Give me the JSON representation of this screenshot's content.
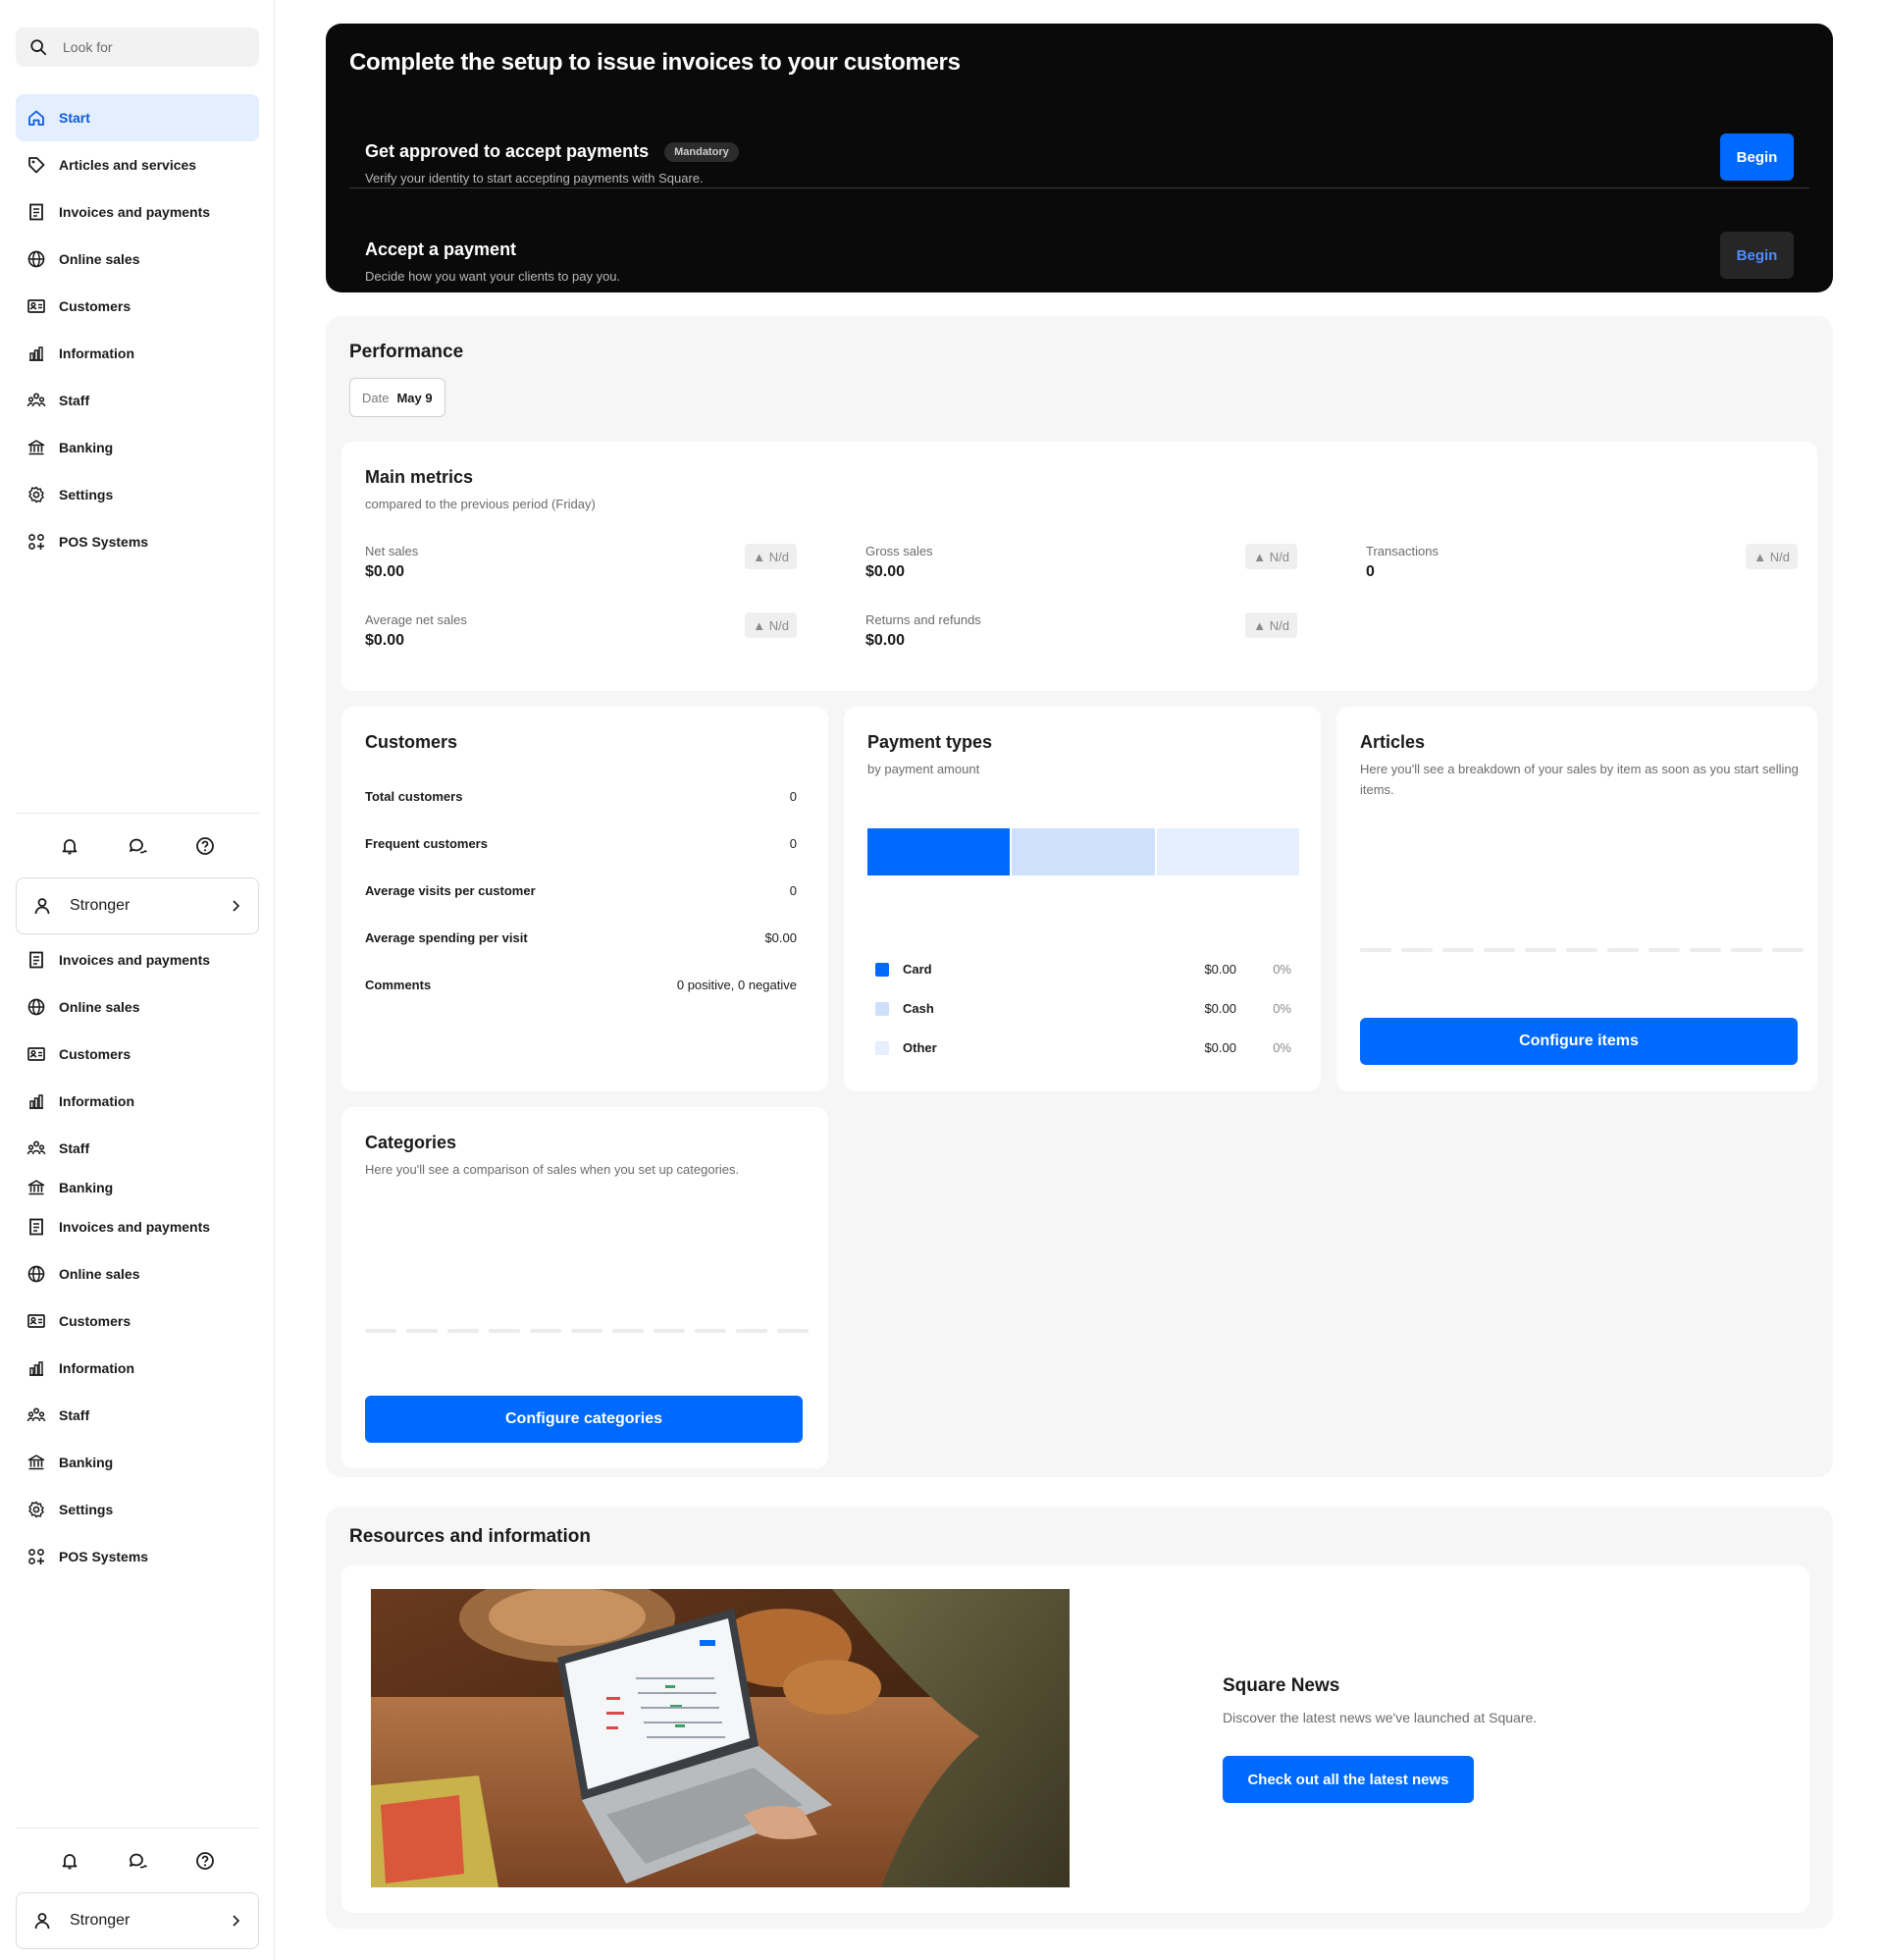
{
  "search": {
    "placeholder": "Look for"
  },
  "nav_primary": [
    {
      "label": "Start",
      "icon": "home-icon",
      "active": true
    },
    {
      "label": "Articles and services",
      "icon": "tag-icon"
    },
    {
      "label": "Invoices and payments",
      "icon": "invoice-icon"
    },
    {
      "label": "Online sales",
      "icon": "globe-icon"
    },
    {
      "label": "Customers",
      "icon": "contact-card-icon"
    },
    {
      "label": "Information",
      "icon": "bar-chart-icon"
    },
    {
      "label": "Staff",
      "icon": "people-icon"
    },
    {
      "label": "Banking",
      "icon": "bank-icon"
    },
    {
      "label": "Settings",
      "icon": "gear-icon"
    },
    {
      "label": "POS Systems",
      "icon": "apps-icon"
    }
  ],
  "nav_repeat_a": [
    {
      "label": "Invoices and payments",
      "icon": "invoice-icon"
    },
    {
      "label": "Online sales",
      "icon": "globe-icon"
    },
    {
      "label": "Customers",
      "icon": "contact-card-icon"
    },
    {
      "label": "Information",
      "icon": "bar-chart-icon"
    },
    {
      "label": "Staff",
      "icon": "people-icon"
    },
    {
      "label": "Banking",
      "icon": "bank-icon"
    }
  ],
  "nav_repeat_b": [
    {
      "label": "Invoices and payments",
      "icon": "invoice-icon"
    },
    {
      "label": "Online sales",
      "icon": "globe-icon"
    },
    {
      "label": "Customers",
      "icon": "contact-card-icon"
    },
    {
      "label": "Information",
      "icon": "bar-chart-icon"
    },
    {
      "label": "Staff",
      "icon": "people-icon"
    },
    {
      "label": "Banking",
      "icon": "bank-icon"
    },
    {
      "label": "Settings",
      "icon": "gear-icon"
    },
    {
      "label": "POS Systems",
      "icon": "apps-icon"
    }
  ],
  "user": {
    "name": "Stronger"
  },
  "setup": {
    "title": "Complete the setup to issue invoices to your customers",
    "step1": {
      "title": "Get approved to accept payments",
      "badge": "Mandatory",
      "desc": "Verify your identity to start accepting payments with Square.",
      "button": "Begin"
    },
    "step2": {
      "title": "Accept a payment",
      "desc": "Decide how you want your clients to pay you.",
      "button": "Begin"
    }
  },
  "performance": {
    "title": "Performance",
    "date_label": "Date",
    "date_value": "May 9",
    "main_metrics": {
      "title": "Main metrics",
      "subtitle": "compared to the previous period (Friday)",
      "metrics": [
        {
          "label": "Net sales",
          "value": "$0.00",
          "change": "▲ N/d"
        },
        {
          "label": "Gross sales",
          "value": "$0.00",
          "change": "▲ N/d"
        },
        {
          "label": "Transactions",
          "value": "0",
          "change": "▲ N/d"
        },
        {
          "label": "Average net sales",
          "value": "$0.00",
          "change": "▲ N/d"
        },
        {
          "label": "Returns and refunds",
          "value": "$0.00",
          "change": "▲ N/d"
        }
      ]
    },
    "customers": {
      "title": "Customers",
      "rows": [
        {
          "k": "Total customers",
          "v": "0"
        },
        {
          "k": "Frequent customers",
          "v": "0"
        },
        {
          "k": "Average visits per customer",
          "v": "0"
        },
        {
          "k": "Average spending per visit",
          "v": "$0.00"
        },
        {
          "k": "Comments",
          "v": "0 positive, 0 negative"
        }
      ]
    },
    "payment_types": {
      "title": "Payment types",
      "subtitle": "by payment amount",
      "bar_colors": [
        "#006aff",
        "#cfe0fd",
        "#e6effe"
      ],
      "rows": [
        {
          "label": "Card",
          "amount": "$0.00",
          "pct": "0%",
          "color": "#006aff"
        },
        {
          "label": "Cash",
          "amount": "$0.00",
          "pct": "0%",
          "color": "#cfe0fd"
        },
        {
          "label": "Other",
          "amount": "$0.00",
          "pct": "0%",
          "color": "#e6effe"
        }
      ]
    },
    "articles": {
      "title": "Articles",
      "subtitle": "Here you'll see a breakdown of your sales by item as soon as you start selling items.",
      "button": "Configure items"
    },
    "categories": {
      "title": "Categories",
      "subtitle": "Here you'll see a comparison of sales when you set up categories.",
      "button": "Configure categories"
    }
  },
  "resources": {
    "title": "Resources and information",
    "news_title": "Square News",
    "news_subtitle": "Discover the latest news we've launched at Square.",
    "news_button": "Check out all the latest news"
  }
}
